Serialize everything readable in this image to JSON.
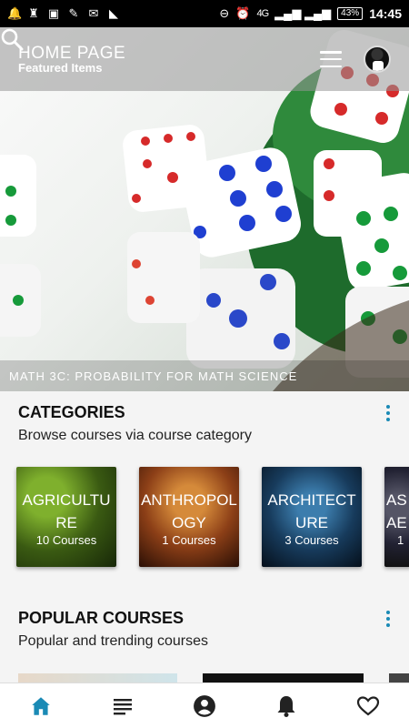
{
  "status_bar": {
    "signal": "4G",
    "battery": "43%",
    "time": "14:45"
  },
  "app_bar": {
    "title": "HOME PAGE",
    "subtitle": "Featured Items"
  },
  "hero": {
    "caption": "MATH 3C: PROBABILITY FOR MATH SCIENCE"
  },
  "categories": {
    "title": "CATEGORIES",
    "subtitle": "Browse courses via course category",
    "items": [
      {
        "name": "AGRICULTURE",
        "count": "10 Courses"
      },
      {
        "name": "ANTHROPOLOGY",
        "count": "1 Courses"
      },
      {
        "name": "ARCHITECTURE",
        "count": "3 Courses"
      },
      {
        "name": "AS AE",
        "count": "1"
      }
    ]
  },
  "popular": {
    "title": "POPULAR COURSES",
    "subtitle": "Popular and trending courses"
  },
  "bottom_nav": {
    "items": [
      "home-icon",
      "list-icon",
      "account-icon",
      "bell-icon",
      "heart-icon"
    ],
    "active_color": "#1a8ab5",
    "inactive_color": "#222222"
  },
  "colors": {
    "accent": "#1a8ab5",
    "app_bar": "#969696",
    "background": "#f4f4f4"
  }
}
